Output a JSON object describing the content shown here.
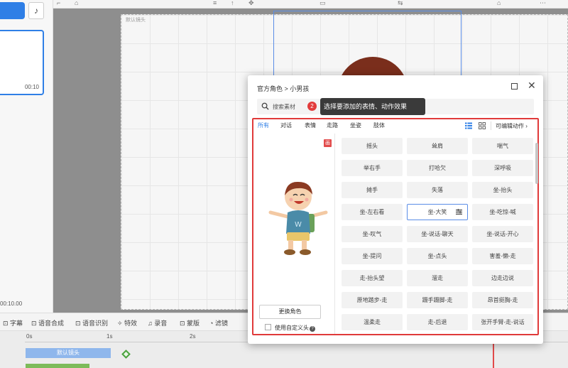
{
  "editor": {
    "scene_duration": "00:10",
    "current_time": "00:10.00",
    "canvas_label": "默认镜头",
    "toolbar_items": [
      "字幕",
      "语音合成",
      "语音识别",
      "特效",
      "录音",
      "蒙版",
      "滤镜"
    ],
    "ruler_ticks": [
      "0s",
      "1s",
      "2s"
    ],
    "clip_label": "默认镜头"
  },
  "dialog": {
    "breadcrumb": "官方角色 > 小男孩",
    "search": {
      "placeholder": "搜索素材"
    },
    "step_badge": "2",
    "tooltip": "选择要添加的表情、动作效果",
    "tabs": [
      "所有",
      "对话",
      "表情",
      "走路",
      "坐姿",
      "肢体"
    ],
    "active_tab": "所有",
    "editable_actions_label": "可编辑动作",
    "preview_tag": "画",
    "change_role_label": "更换角色",
    "custom_head_label": "使用自定义头",
    "actions": [
      "摇头",
      "耸肩",
      "喘气",
      "举右手",
      "打哈欠",
      "深呼吸",
      "摊手",
      "失落",
      "坐-抬头",
      "坐-左右看",
      "坐-大笑",
      "坐-吃惊-喊",
      "坐-叹气",
      "坐-说话-聊天",
      "坐-说话-开心",
      "坐-提问",
      "坐-点头",
      "害羞-懒-走",
      "走-抬头望",
      "溜走",
      "边走边说",
      "原地踏步-走",
      "蹑手蹑脚-走",
      "昂首挺胸-走",
      "温柔走",
      "走-后退",
      "张开手臂-走-说话"
    ],
    "selected_action": "坐-大笑",
    "colors": {
      "accent": "#2f7fe6",
      "highlight_frame": "#e03a3a",
      "tooltip_bg": "#3a3a3a"
    }
  }
}
